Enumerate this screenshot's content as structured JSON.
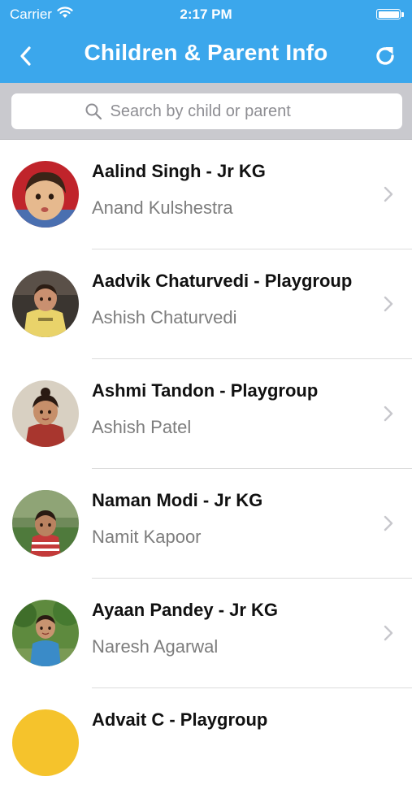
{
  "status_bar": {
    "carrier": "Carrier",
    "time": "2:17 PM",
    "icons": [
      "wifi-icon",
      "battery-icon"
    ]
  },
  "nav": {
    "title": "Children & Parent Info",
    "back_icon": "chevron-left-icon",
    "refresh_icon": "refresh-icon"
  },
  "search": {
    "placeholder": "Search by child or parent",
    "value": "",
    "icon": "search-icon"
  },
  "children": [
    {
      "title": "Aalind Singh - Jr KG",
      "parent": "Anand Kulshestra"
    },
    {
      "title": "Aadvik Chaturvedi - Playgroup",
      "parent": "Ashish Chaturvedi"
    },
    {
      "title": "Ashmi Tandon - Playgroup",
      "parent": "Ashish Patel"
    },
    {
      "title": "Naman Modi - Jr KG",
      "parent": "Namit Kapoor"
    },
    {
      "title": "Ayaan Pandey - Jr KG",
      "parent": "Naresh Agarwal"
    },
    {
      "title": "Advait C - Playgroup",
      "parent": ""
    }
  ],
  "colors": {
    "accent": "#3ba7ec",
    "search_bar_bg": "#c9c9ce",
    "subtitle": "#7d7d7d",
    "chevron": "#c7c7cc"
  }
}
